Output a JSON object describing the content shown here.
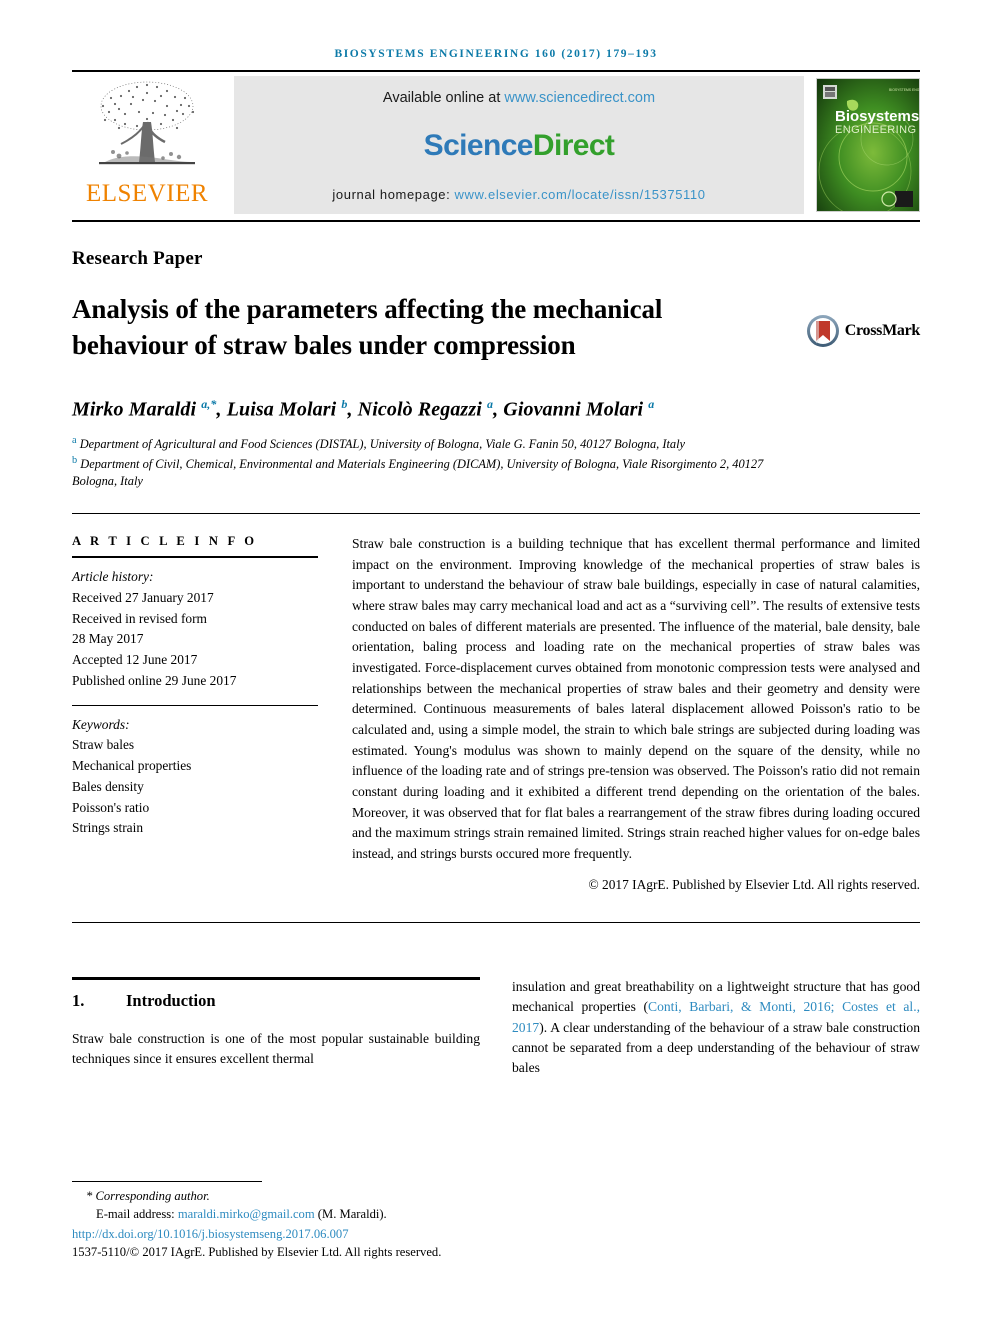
{
  "running_head": "Biosystems Engineering 160 (2017) 179–193",
  "masthead": {
    "publisher_name": "ELSEVIER",
    "available_text": "Available online at ",
    "available_url": "www.sciencedirect.com",
    "sciencedirect_part1": "Science",
    "sciencedirect_part2": "Direct",
    "homepage_label": "journal homepage: ",
    "homepage_url": "www.elsevier.com/locate/issn/15375110",
    "cover_title_line1": "Biosystems",
    "cover_title_line2": "ENGINEERING"
  },
  "article": {
    "type_label": "Research Paper",
    "title": "Analysis of the parameters affecting the mechanical behaviour of straw bales under compression",
    "crossmark_label": "CrossMark",
    "authors_html": "Mirko Maraldi <sup>a,*</sup>, Luisa Molari <sup>b</sup>, Nicolò Regazzi <sup>a</sup>, Giovanni Molari <sup>a</sup>",
    "affiliations": [
      "Department of Agricultural and Food Sciences (DISTAL), University of Bologna, Viale G. Fanin 50, 40127 Bologna, Italy",
      "Department of Civil, Chemical, Environmental and Materials Engineering (DICAM), University of Bologna, Viale Risorgimento 2, 40127 Bologna, Italy"
    ],
    "affiliation_marks": [
      "a",
      "b"
    ]
  },
  "article_info": {
    "heading": "A R T I C L E   I N F O",
    "history_label": "Article history:",
    "history": [
      "Received 27 January 2017",
      "Received in revised form",
      "28 May 2017",
      "Accepted 12 June 2017",
      "Published online 29 June 2017"
    ],
    "keywords_label": "Keywords:",
    "keywords": [
      "Straw bales",
      "Mechanical properties",
      "Bales density",
      "Poisson's ratio",
      "Strings strain"
    ]
  },
  "abstract": {
    "text": "Straw bale construction is a building technique that has excellent thermal performance and limited impact on the environment. Improving knowledge of the mechanical properties of straw bales is important to understand the behaviour of straw bale buildings, especially in case of natural calamities, where straw bales may carry mechanical load and act as a “surviving cell”. The results of extensive tests conducted on bales of different materials are presented. The influence of the material, bale density, bale orientation, baling process and loading rate on the mechanical properties of straw bales was investigated. Force-displacement curves obtained from monotonic compression tests were analysed and relationships between the mechanical properties of straw bales and their geometry and density were determined. Continuous measurements of bales lateral displacement allowed Poisson's ratio to be calculated and, using a simple model, the strain to which bale strings are subjected during loading was estimated. Young's modulus was shown to mainly depend on the square of the density, while no influence of the loading rate and of strings pre-tension was observed. The Poisson's ratio did not remain constant during loading and it exhibited a different trend depending on the orientation of the bales. Moreover, it was observed that for flat bales a rearrangement of the straw fibres during loading occured and the maximum strings strain remained limited. Strings strain reached higher values for on-edge bales instead, and strings bursts occured more frequently.",
    "copyright": "© 2017 IAgrE. Published by Elsevier Ltd. All rights reserved."
  },
  "body": {
    "intro_number": "1.",
    "intro_title": "Introduction",
    "left_paragraph": "Straw bale construction is one of the most popular sustainable building techniques since it ensures excellent thermal",
    "right_paragraph_pre": "insulation and great breathability on a lightweight structure that has good mechanical properties (",
    "right_citation": "Conti, Barbari, & Monti, 2016; Costes et al., 2017",
    "right_paragraph_post": "). A clear understanding of the behaviour of a straw bale construction cannot be separated from a deep understanding of the behaviour of straw bales"
  },
  "footnote": {
    "corresponding": "* Corresponding author.",
    "email_label": "E-mail address: ",
    "email_address": "maraldi.mirko@gmail.com",
    "email_suffix": " (M. Maraldi).",
    "doi": "http://dx.doi.org/10.1016/j.biosystemseng.2017.06.007",
    "issn_line": "1537-5110/© 2017 IAgrE. Published by Elsevier Ltd. All rights reserved."
  },
  "colors": {
    "running_head": "#0c7aa8",
    "link": "#2e8bc0",
    "elsevier_orange": "#ef8200",
    "sciencedirect_green": "#33a02c",
    "sciencedirect_blue": "#2e7ab8"
  }
}
